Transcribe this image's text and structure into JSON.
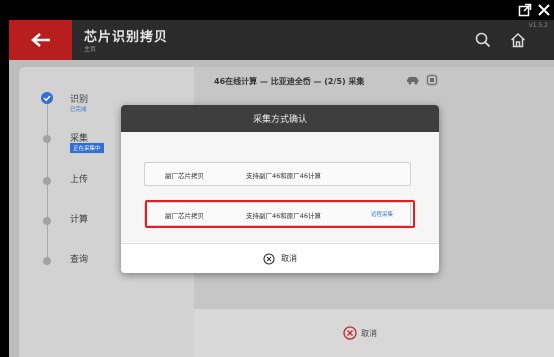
{
  "header": {
    "title": "芯片识别拷贝",
    "subtitle": "主页",
    "version": "V1.5.2"
  },
  "steps": [
    {
      "label": "识别",
      "sub": "已完成",
      "state": "done"
    },
    {
      "label": "采集",
      "sub": "正在采集中",
      "state": "active"
    },
    {
      "label": "上传",
      "sub": "",
      "state": "pending"
    },
    {
      "label": "计算",
      "sub": "",
      "state": "pending"
    },
    {
      "label": "查询",
      "sub": "",
      "state": "pending"
    }
  ],
  "main": {
    "title": "46在线计算 — 比亚迪全岙 — (2/5) 采集",
    "cancel_label": "取消"
  },
  "dialog": {
    "title": "采集方式确认",
    "options": [
      {
        "col1": "副厂芯片拷贝",
        "col2": "支持副厂46和原厂46计算",
        "col3": ""
      },
      {
        "col1": "副厂芯片拷贝",
        "col2": "支持副厂46和原厂46计算",
        "col3": "远程采集"
      }
    ],
    "cancel_label": "取消"
  },
  "colors": {
    "accent_red": "#b81e1e",
    "highlight_red": "#e32020",
    "step_blue": "#2f6fd6",
    "link_blue": "#2f7bd8"
  }
}
